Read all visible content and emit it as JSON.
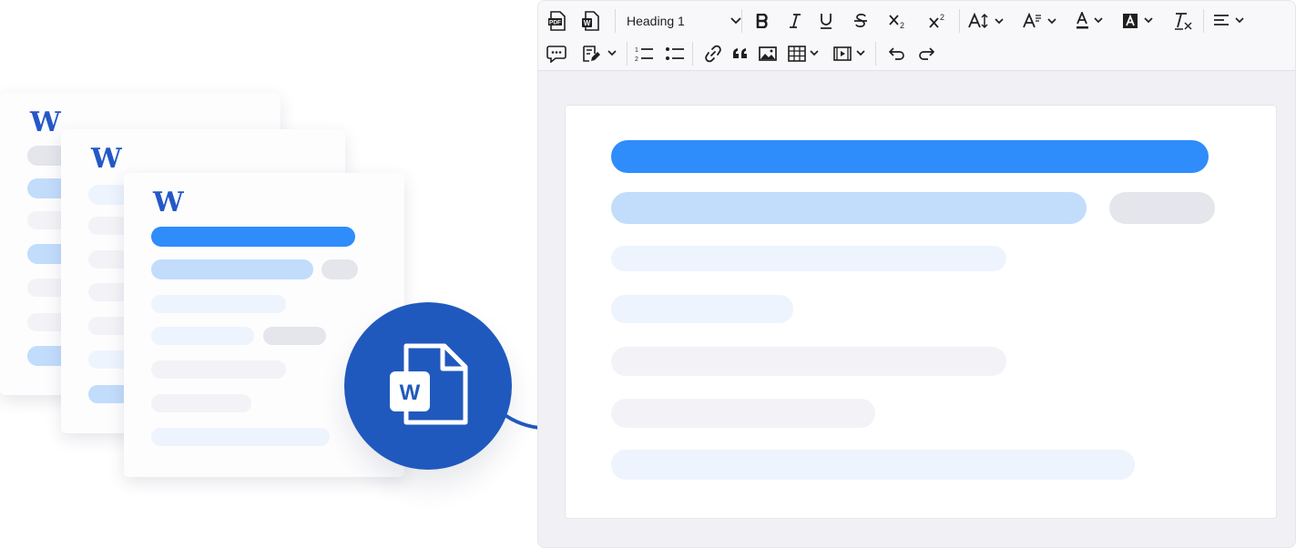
{
  "documents": [
    {
      "logo": "W"
    },
    {
      "logo": "W"
    },
    {
      "logo": "W"
    }
  ],
  "convert_badge": {
    "icon": "word-file-icon",
    "letter": "W",
    "color": "#2059bd"
  },
  "toolbar": {
    "row1": [
      {
        "name": "export-pdf-button",
        "icon": "pdf-file-icon"
      },
      {
        "name": "export-word-button",
        "icon": "word-file-icon"
      },
      {
        "name": "heading-select",
        "value": "Heading 1"
      },
      {
        "name": "bold-button",
        "icon": "bold-icon"
      },
      {
        "name": "italic-button",
        "icon": "italic-icon"
      },
      {
        "name": "underline-button",
        "icon": "underline-icon"
      },
      {
        "name": "strikethrough-button",
        "icon": "strikethrough-icon"
      },
      {
        "name": "subscript-button",
        "icon": "subscript-icon"
      },
      {
        "name": "superscript-button",
        "icon": "superscript-icon"
      },
      {
        "name": "font-size-button",
        "icon": "font-size-icon"
      },
      {
        "name": "font-family-button",
        "icon": "font-family-icon"
      },
      {
        "name": "font-color-button",
        "icon": "font-color-icon"
      },
      {
        "name": "highlight-color-button",
        "icon": "highlight-icon"
      },
      {
        "name": "remove-format-button",
        "icon": "clear-format-icon"
      },
      {
        "name": "align-button",
        "icon": "align-left-icon"
      }
    ],
    "row2": [
      {
        "name": "comment-button",
        "icon": "comment-icon"
      },
      {
        "name": "track-changes-button",
        "icon": "edit-document-icon"
      },
      {
        "name": "numbered-list-button",
        "icon": "numbered-list-icon"
      },
      {
        "name": "bulleted-list-button",
        "icon": "bulleted-list-icon"
      },
      {
        "name": "link-button",
        "icon": "link-icon"
      },
      {
        "name": "blockquote-button",
        "icon": "quote-icon"
      },
      {
        "name": "image-button",
        "icon": "image-icon"
      },
      {
        "name": "table-button",
        "icon": "table-icon"
      },
      {
        "name": "media-button",
        "icon": "media-icon"
      },
      {
        "name": "undo-button",
        "icon": "undo-icon"
      },
      {
        "name": "redo-button",
        "icon": "redo-icon"
      }
    ],
    "heading_value": "Heading 1",
    "sub_label": "2",
    "sup_label": "2"
  },
  "colors": {
    "accent": "#2f8cfb",
    "brand_blue": "#2059bd",
    "placeholder_light_blue": "#c2dcfc",
    "placeholder_gray": "#e4e6ec"
  }
}
